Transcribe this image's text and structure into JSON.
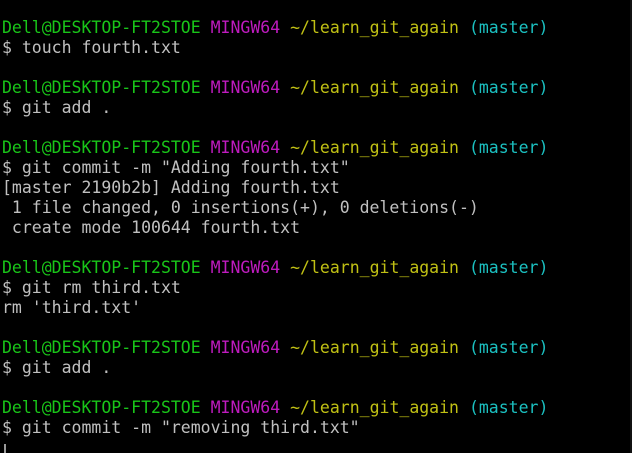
{
  "prompt": {
    "user_host": "Dell@DESKTOP-FT2STOE",
    "system": "MINGW64",
    "path": "~/learn_git_again",
    "branch": "(master)"
  },
  "blocks": [
    {
      "command": "$ touch fourth.txt",
      "output": []
    },
    {
      "command": "$ git add .",
      "output": []
    },
    {
      "command": "$ git commit -m \"Adding fourth.txt\"",
      "output": [
        "[master 2190b2b] Adding fourth.txt",
        " 1 file changed, 0 insertions(+), 0 deletions(-)",
        " create mode 100644 fourth.txt"
      ]
    },
    {
      "command": "$ git rm third.txt",
      "output": [
        "rm 'third.txt'"
      ]
    },
    {
      "command": "$ git add .",
      "output": []
    },
    {
      "command": "$ git commit -m \"removing third.txt\"",
      "output": []
    }
  ],
  "colors": {
    "background": "#000000",
    "user_host": "#19c519",
    "system": "#bf1bbf",
    "path": "#c0c014",
    "branch": "#1bc0c0",
    "text": "#c0c0c0"
  }
}
